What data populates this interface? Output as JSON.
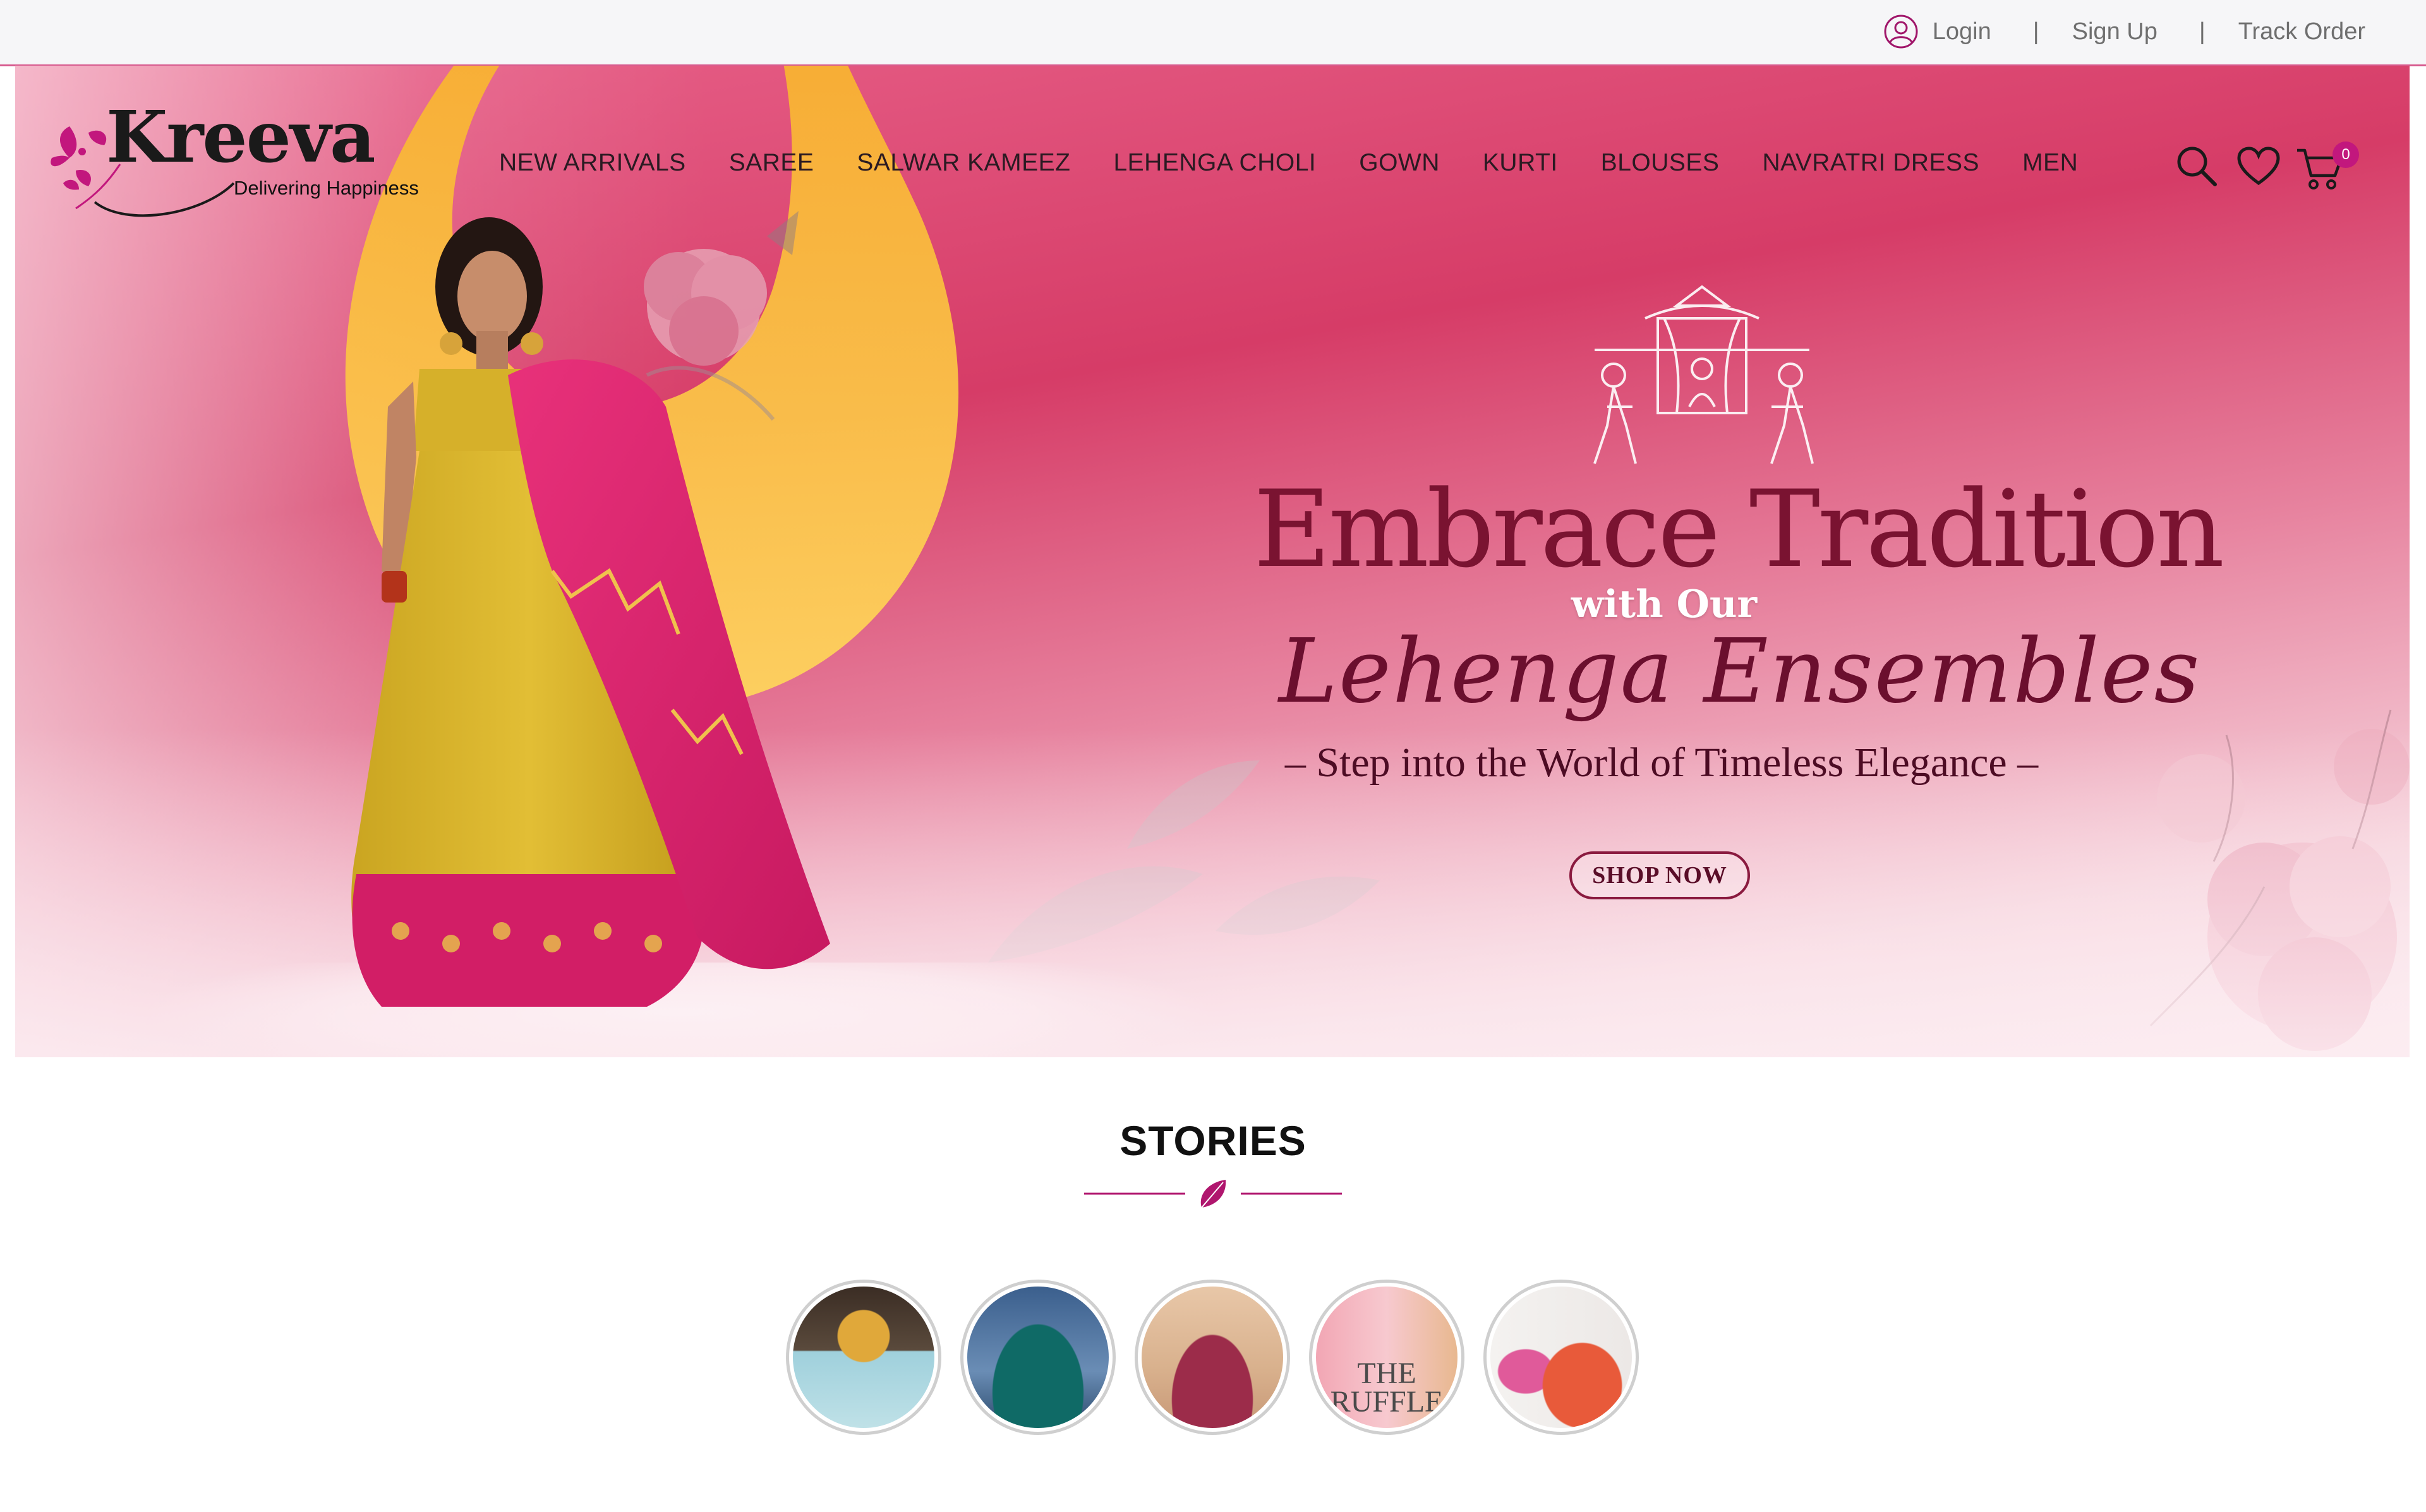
{
  "topbar": {
    "login_label": "Login",
    "signup_label": "Sign Up",
    "track_order_label": "Track Order",
    "separator": "|"
  },
  "brand": {
    "name": "Kreeva",
    "tagline": "Delivering Happiness",
    "color": "#c2177d"
  },
  "nav": {
    "items": [
      {
        "label": "NEW ARRIVALS"
      },
      {
        "label": "SAREE"
      },
      {
        "label": "SALWAR KAMEEZ"
      },
      {
        "label": "LEHENGA CHOLI"
      },
      {
        "label": "GOWN"
      },
      {
        "label": "KURTI"
      },
      {
        "label": "BLOUSES"
      },
      {
        "label": "NAVRATRI DRESS"
      },
      {
        "label": "MEN"
      }
    ],
    "cart_count": "0",
    "icons": [
      "search-icon",
      "heart-icon",
      "cart-icon"
    ]
  },
  "hero": {
    "headline": "Embrace Tradition",
    "subheadline": "with Our",
    "script_line": "Lehenga Ensembles",
    "tagline": "– Step into the World of Timeless Elegance –",
    "cta_label": "SHOP NOW"
  },
  "stories": {
    "title": "STORIES",
    "items": [
      {
        "name": "story-1",
        "caption": ""
      },
      {
        "name": "story-2",
        "caption": ""
      },
      {
        "name": "story-3",
        "caption": ""
      },
      {
        "name": "story-4",
        "caption": "THE RUFFLE"
      },
      {
        "name": "story-5",
        "caption": ""
      }
    ]
  }
}
